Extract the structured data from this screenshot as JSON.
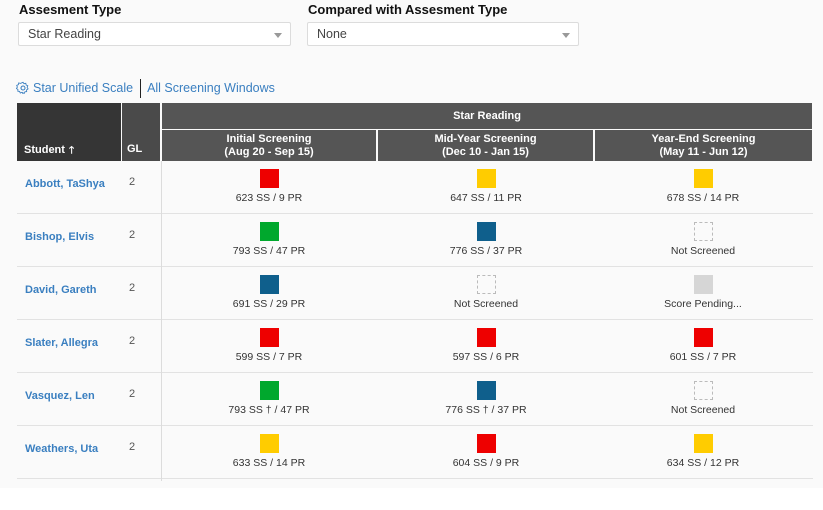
{
  "filters": {
    "assessment_type": {
      "label": "Assesment Type",
      "value": "Star Reading"
    },
    "compared_with": {
      "label": "Compared with Assesment Type",
      "value": "None"
    }
  },
  "links": {
    "scale": {
      "icon": "gear-icon",
      "label": "Star Unified Scale"
    },
    "windows": {
      "label": "All Screening Windows"
    }
  },
  "colors": {
    "red": "#ee0000",
    "yellow": "#ffcc00",
    "green": "#00a82d",
    "blue": "#0f5f8c",
    "pending": "#d6d6d6",
    "link": "#3a7fc0",
    "header_dark": "#353535",
    "header_mid": "#555555"
  },
  "table": {
    "headers": {
      "student": "Student",
      "sort_icon": "arrow-up-icon",
      "gl": "GL",
      "group": "Star Reading",
      "windows": [
        {
          "name": "Initial Screening",
          "dates": "(Aug 20 - Sep 15)"
        },
        {
          "name": "Mid-Year Screening",
          "dates": "(Dec 10 - Jan 15)"
        },
        {
          "name": "Year-End Screening",
          "dates": "(May 11 - Jun 12)"
        }
      ]
    },
    "rows": [
      {
        "student": "Abbott, TaShya",
        "gl": "2",
        "scores": [
          {
            "status": "red",
            "text": "623 SS / 9 PR"
          },
          {
            "status": "yellow",
            "text": "647 SS / 11 PR"
          },
          {
            "status": "yellow",
            "text": "678 SS / 14 PR"
          }
        ]
      },
      {
        "student": "Bishop, Elvis",
        "gl": "2",
        "scores": [
          {
            "status": "green",
            "text": "793 SS / 47 PR"
          },
          {
            "status": "blue",
            "text": "776 SS / 37 PR"
          },
          {
            "status": "empty",
            "text": "Not Screened"
          }
        ]
      },
      {
        "student": "David, Gareth",
        "gl": "2",
        "scores": [
          {
            "status": "blue",
            "text": "691 SS / 29 PR"
          },
          {
            "status": "empty",
            "text": "Not Screened"
          },
          {
            "status": "pending",
            "text": "Score Pending..."
          }
        ]
      },
      {
        "student": "Slater, Allegra",
        "gl": "2",
        "scores": [
          {
            "status": "red",
            "text": "599 SS / 7 PR"
          },
          {
            "status": "red",
            "text": "597 SS / 6 PR"
          },
          {
            "status": "red",
            "text": "601 SS / 7 PR"
          }
        ]
      },
      {
        "student": "Vasquez, Len",
        "gl": "2",
        "scores": [
          {
            "status": "green",
            "text": "793 SS † / 47 PR"
          },
          {
            "status": "blue",
            "text": "776 SS † / 37 PR"
          },
          {
            "status": "empty",
            "text": "Not Screened"
          }
        ]
      },
      {
        "student": "Weathers, Uta",
        "gl": "2",
        "scores": [
          {
            "status": "yellow",
            "text": "633 SS / 14 PR"
          },
          {
            "status": "red",
            "text": "604 SS / 9 PR"
          },
          {
            "status": "yellow",
            "text": "634 SS / 12 PR"
          }
        ]
      }
    ]
  }
}
